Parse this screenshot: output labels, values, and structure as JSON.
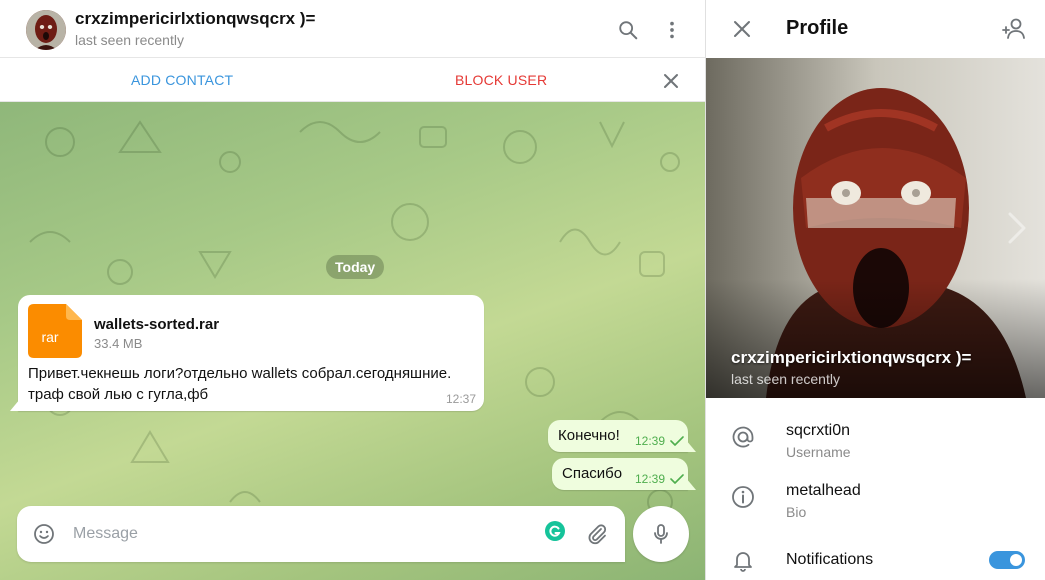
{
  "colors": {
    "accent": "#3a95dd",
    "danger": "#e53935",
    "outgoing_bubble": "#effdde",
    "file_icon": "#fb8c00",
    "read_check": "#4fae4e"
  },
  "chat": {
    "title": "crxzimpericirlxtionqwsqcrx )=",
    "status": "last seen recently",
    "icons": {
      "search": "search-icon",
      "menu": "more-vert-icon"
    }
  },
  "action_bar": {
    "add_contact": "ADD CONTACT",
    "block_user": "BLOCK USER",
    "close_icon": "close-icon"
  },
  "messages": {
    "date": "Today",
    "incoming": {
      "file_ext": "rar",
      "file_name": "wallets-sorted.rar",
      "file_size": "33.4 MB",
      "text": "Привет.чекнешь логи?отдельно wallets собрал.сегодняшние. траф свой лью с гугла,фб",
      "time": "12:37"
    },
    "outgoing": [
      {
        "text": "Конечно!",
        "time": "12:39"
      },
      {
        "text": "Спасибо",
        "time": "12:39"
      }
    ]
  },
  "composer": {
    "placeholder": "Message",
    "icons": {
      "emoji": "smile-icon",
      "attach": "paperclip-icon",
      "mic": "microphone-icon",
      "grammarly": "grammarly-icon"
    }
  },
  "profile": {
    "title": "Profile",
    "name": "crxzimpericirlxtionqwsqcrx )=",
    "status": "last seen recently",
    "username": {
      "value": "sqcrxti0n",
      "label": "Username"
    },
    "bio": {
      "value": "metalhead",
      "label": "Bio"
    },
    "notifications": {
      "label": "Notifications",
      "enabled": true
    }
  }
}
